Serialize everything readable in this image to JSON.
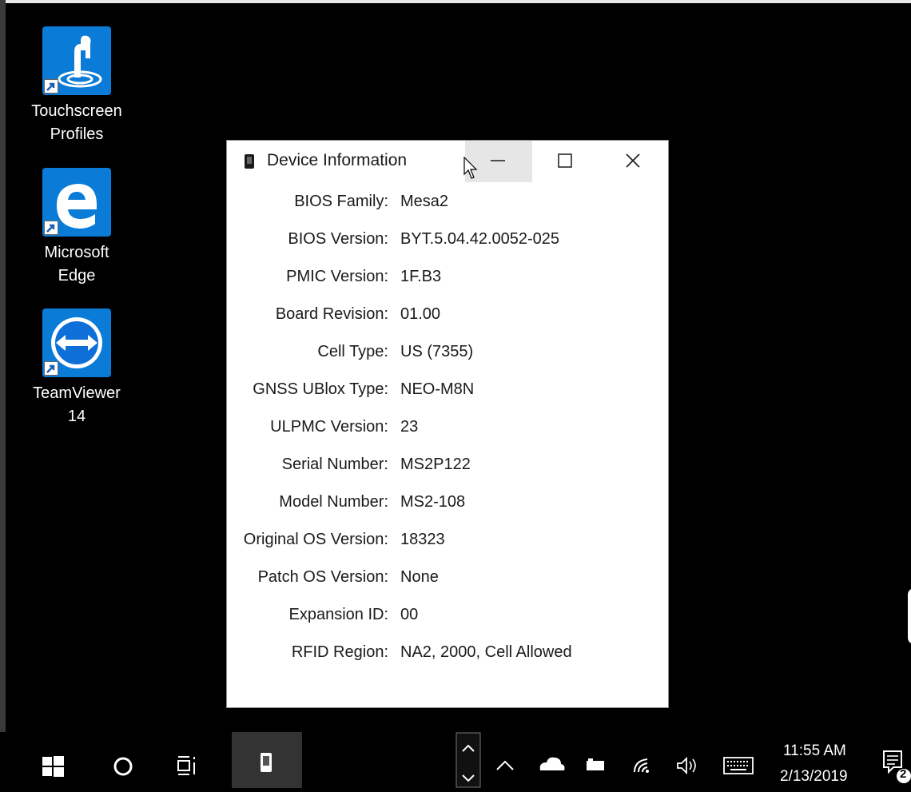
{
  "desktop": {
    "icons": [
      {
        "label": "Touchscreen\nProfiles",
        "icon": "touchscreen-profiles-icon"
      },
      {
        "label": "Microsoft\nEdge",
        "icon": "edge-icon"
      },
      {
        "label": "TeamViewer\n14",
        "icon": "teamviewer-icon"
      }
    ]
  },
  "dialog": {
    "title": "Device Information",
    "fields": [
      {
        "label": "BIOS Family:",
        "value": "Mesa2"
      },
      {
        "label": "BIOS Version:",
        "value": "BYT.5.04.42.0052-025"
      },
      {
        "label": "PMIC Version:",
        "value": "1F.B3"
      },
      {
        "label": "Board Revision:",
        "value": "01.00"
      },
      {
        "label": "Cell Type:",
        "value": "US (7355)"
      },
      {
        "label": "GNSS UBlox Type:",
        "value": "NEO-M8N"
      },
      {
        "label": "ULPMC Version:",
        "value": "23"
      },
      {
        "label": "Serial Number:",
        "value": "MS2P122"
      },
      {
        "label": "Model Number:",
        "value": "MS2-108"
      },
      {
        "label": "Original OS Version:",
        "value": "18323"
      },
      {
        "label": "Patch OS Version:",
        "value": "None"
      },
      {
        "label": "Expansion ID:",
        "value": "00"
      },
      {
        "label": "RFID Region:",
        "value": "NA2, 2000, Cell Allowed"
      }
    ]
  },
  "taskbar": {
    "clock_time": "11:55 AM",
    "clock_date": "2/13/2019",
    "notification_count": "2"
  },
  "colors": {
    "desktop_background": "#000000",
    "icon_tile_blue": "#0a7bd6",
    "dialog_background": "#ffffff",
    "minimize_hover": "#e6e6e6"
  }
}
